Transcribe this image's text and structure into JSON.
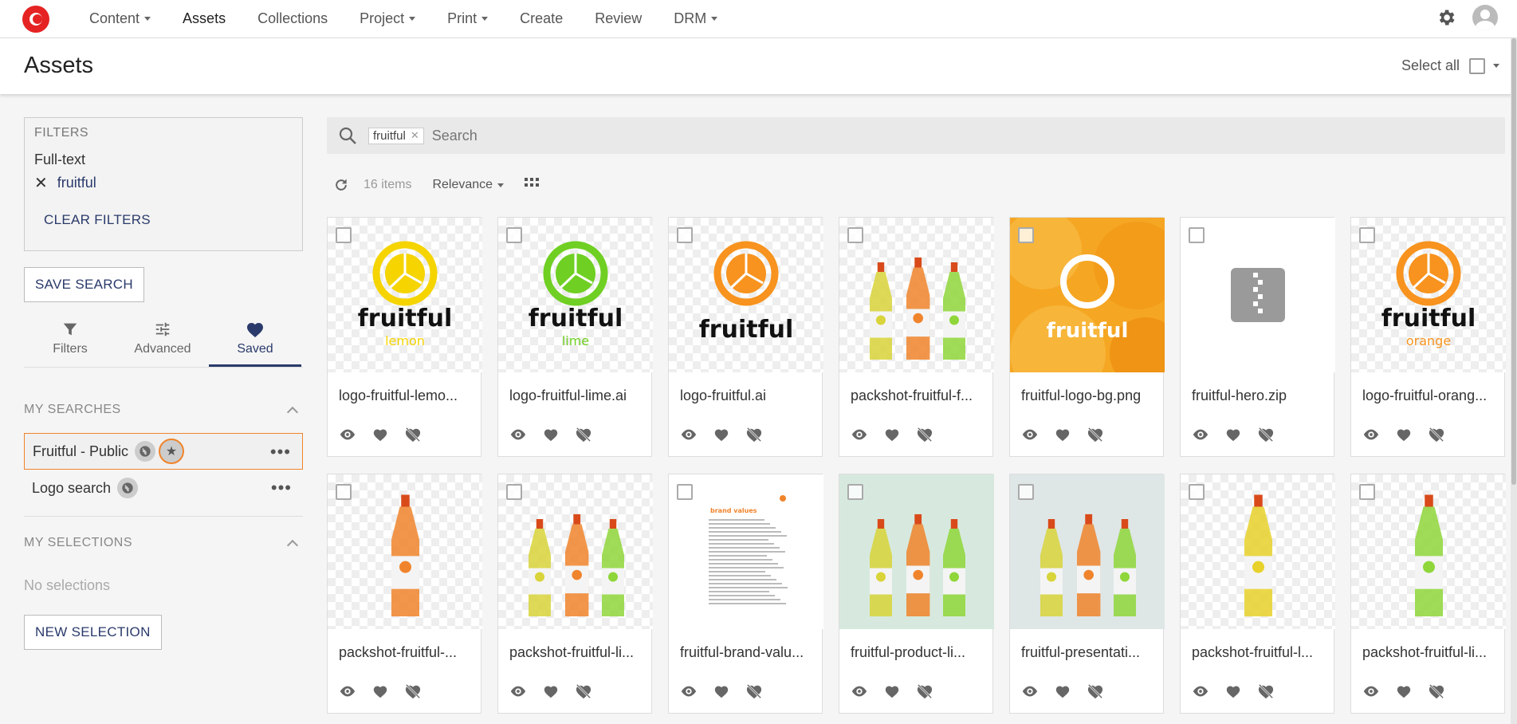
{
  "nav": {
    "items": [
      {
        "label": "Content",
        "dropdown": true
      },
      {
        "label": "Assets",
        "dropdown": false,
        "active": true
      },
      {
        "label": "Collections",
        "dropdown": false
      },
      {
        "label": "Project",
        "dropdown": true
      },
      {
        "label": "Print",
        "dropdown": true
      },
      {
        "label": "Create",
        "dropdown": false
      },
      {
        "label": "Review",
        "dropdown": false
      },
      {
        "label": "DRM",
        "dropdown": true
      }
    ]
  },
  "header": {
    "title": "Assets",
    "select_all": "Select all"
  },
  "filters": {
    "heading": "FILTERS",
    "fulltext_label": "Full-text",
    "fulltext_value": "fruitful",
    "clear": "CLEAR FILTERS"
  },
  "save_search": "SAVE SEARCH",
  "tabs": [
    {
      "label": "Filters",
      "icon": "funnel-icon"
    },
    {
      "label": "Advanced",
      "icon": "sliders-icon"
    },
    {
      "label": "Saved",
      "icon": "heart-icon",
      "active": true
    }
  ],
  "my_searches": {
    "heading": "MY SEARCHES",
    "items": [
      {
        "label": "Fruitful - Public",
        "icons": [
          "globe-icon",
          "star-icon"
        ]
      },
      {
        "label": "Logo search",
        "icons": [
          "globe-icon"
        ]
      }
    ]
  },
  "my_selections": {
    "heading": "MY SELECTIONS",
    "empty": "No selections",
    "new_button": "NEW SELECTION"
  },
  "search": {
    "token": "fruitful",
    "placeholder": "Search"
  },
  "toolbar": {
    "count": "16 items",
    "sort": "Relevance"
  },
  "colors": {
    "accent": "#2a3a6b",
    "highlight": "#f0842c",
    "lemon": "#f5d400",
    "lime": "#7ed321",
    "orange": "#f7931e"
  },
  "assets": [
    {
      "name": "logo-fruitful-lemo...",
      "thumb": "logo",
      "color": "#f5d400",
      "word": "fruitful",
      "sub": "lemon"
    },
    {
      "name": "logo-fruitful-lime.ai",
      "thumb": "logo",
      "color": "#6fcf22",
      "word": "fruitful",
      "sub": "lime"
    },
    {
      "name": "logo-fruitful.ai",
      "thumb": "logo",
      "color": "#f7931e",
      "word": "fruitful",
      "sub": ""
    },
    {
      "name": "packshot-fruitful-f...",
      "thumb": "bottles3"
    },
    {
      "name": "fruitful-logo-bg.png",
      "thumb": "orangebg",
      "word": "fruitful"
    },
    {
      "name": "fruitful-hero.zip",
      "thumb": "zip"
    },
    {
      "name": "logo-fruitful-orang...",
      "thumb": "logo",
      "color": "#f7931e",
      "word": "fruitful",
      "sub": "orange"
    },
    {
      "name": "packshot-fruitful-...",
      "thumb": "bottle1",
      "color": "#f0842c"
    },
    {
      "name": "packshot-fruitful-li...",
      "thumb": "bottles3b"
    },
    {
      "name": "fruitful-brand-valu...",
      "thumb": "doc",
      "doc_title": "brand values"
    },
    {
      "name": "fruitful-product-li...",
      "thumb": "bottles3c"
    },
    {
      "name": "fruitful-presentati...",
      "thumb": "bottles3d"
    },
    {
      "name": "packshot-fruitful-l...",
      "thumb": "bottle1",
      "color": "#e8d12a"
    },
    {
      "name": "packshot-fruitful-li...",
      "thumb": "bottle1",
      "color": "#8fd63a"
    }
  ]
}
